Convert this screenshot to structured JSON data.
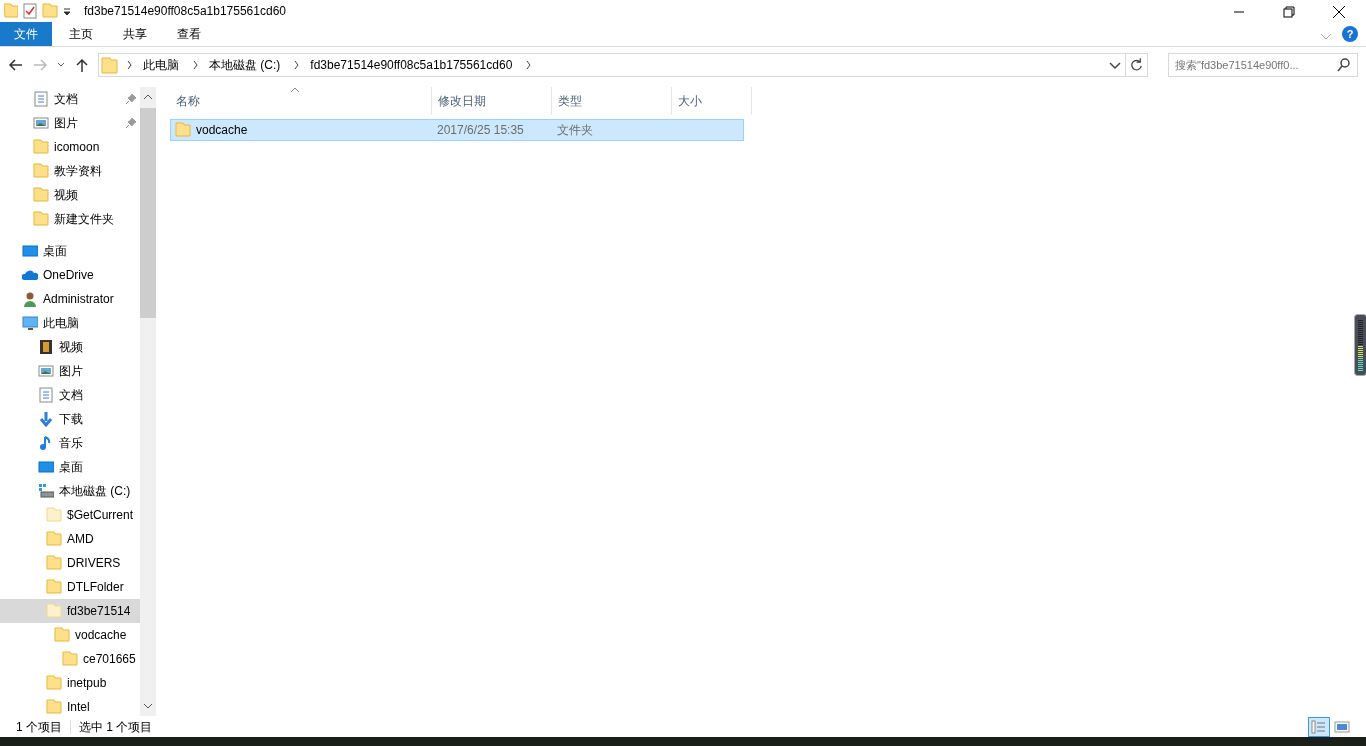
{
  "window": {
    "title": "fd3be71514e90ff08c5a1b175561cd60"
  },
  "ribbon_tabs": [
    {
      "label": "文件",
      "kind": "file",
      "selected": false
    },
    {
      "label": "主页",
      "kind": "tab",
      "selected": false
    },
    {
      "label": "共享",
      "kind": "tab",
      "selected": false
    },
    {
      "label": "查看",
      "kind": "tab",
      "selected": false
    }
  ],
  "help_button": {
    "label": "?"
  },
  "breadcrumb": [
    "此电脑",
    "本地磁盘 (C:)",
    "fd3be71514e90ff08c5a1b175561cd60"
  ],
  "search": {
    "placeholder": "搜索\"fd3be71514e90ff0..."
  },
  "quick_access": [
    {
      "label": "文档",
      "kind": "doc",
      "pinned": true
    },
    {
      "label": "图片",
      "kind": "picture",
      "pinned": true
    },
    {
      "label": "icomoon",
      "kind": "folder",
      "pinned": false
    },
    {
      "label": "教学资料",
      "kind": "folder",
      "pinned": false
    },
    {
      "label": "视频",
      "kind": "folder",
      "pinned": false
    },
    {
      "label": "新建文件夹",
      "kind": "folder",
      "pinned": false
    }
  ],
  "tree": [
    {
      "label": "桌面",
      "kind": "desktop",
      "selected": false
    },
    {
      "label": "OneDrive",
      "kind": "cloud",
      "selected": false
    },
    {
      "label": "Administrator",
      "kind": "user",
      "selected": false
    },
    {
      "label": "此电脑",
      "kind": "pc",
      "selected": false,
      "children": [
        {
          "label": "视频",
          "kind": "video",
          "selected": false
        },
        {
          "label": "图片",
          "kind": "picture",
          "selected": false
        },
        {
          "label": "文档",
          "kind": "doc",
          "selected": false
        },
        {
          "label": "下载",
          "kind": "download",
          "selected": false
        },
        {
          "label": "音乐",
          "kind": "music",
          "selected": false
        },
        {
          "label": "桌面",
          "kind": "desktop",
          "selected": false
        },
        {
          "label": "本地磁盘 (C:)",
          "kind": "drive",
          "selected": false,
          "children": [
            {
              "label": "$GetCurrent",
              "kind": "hidden-folder",
              "selected": false
            },
            {
              "label": "AMD",
              "kind": "folder",
              "selected": false
            },
            {
              "label": "DRIVERS",
              "kind": "folder",
              "selected": false
            },
            {
              "label": "DTLFolder",
              "kind": "folder",
              "selected": false
            },
            {
              "label": "fd3be71514",
              "kind": "hidden-folder",
              "selected": true,
              "children": [
                {
                  "label": "vodcache",
                  "kind": "folder",
                  "selected": false,
                  "children": [
                    {
                      "label": "ce701665",
                      "kind": "folder",
                      "selected": false
                    }
                  ]
                }
              ]
            },
            {
              "label": "inetpub",
              "kind": "folder",
              "selected": false
            },
            {
              "label": "Intel",
              "kind": "folder",
              "selected": false
            }
          ]
        }
      ]
    }
  ],
  "file_list": {
    "columns": [
      "名称",
      "修改日期",
      "类型",
      "大小"
    ],
    "rows": [
      {
        "name": "vodcache",
        "modified": "2017/6/25 15:35",
        "type": "文件夹",
        "size_text": null,
        "selected": true
      }
    ]
  },
  "status_bar": {
    "count": "1 个项目",
    "selection": "选中 1 个项目"
  }
}
